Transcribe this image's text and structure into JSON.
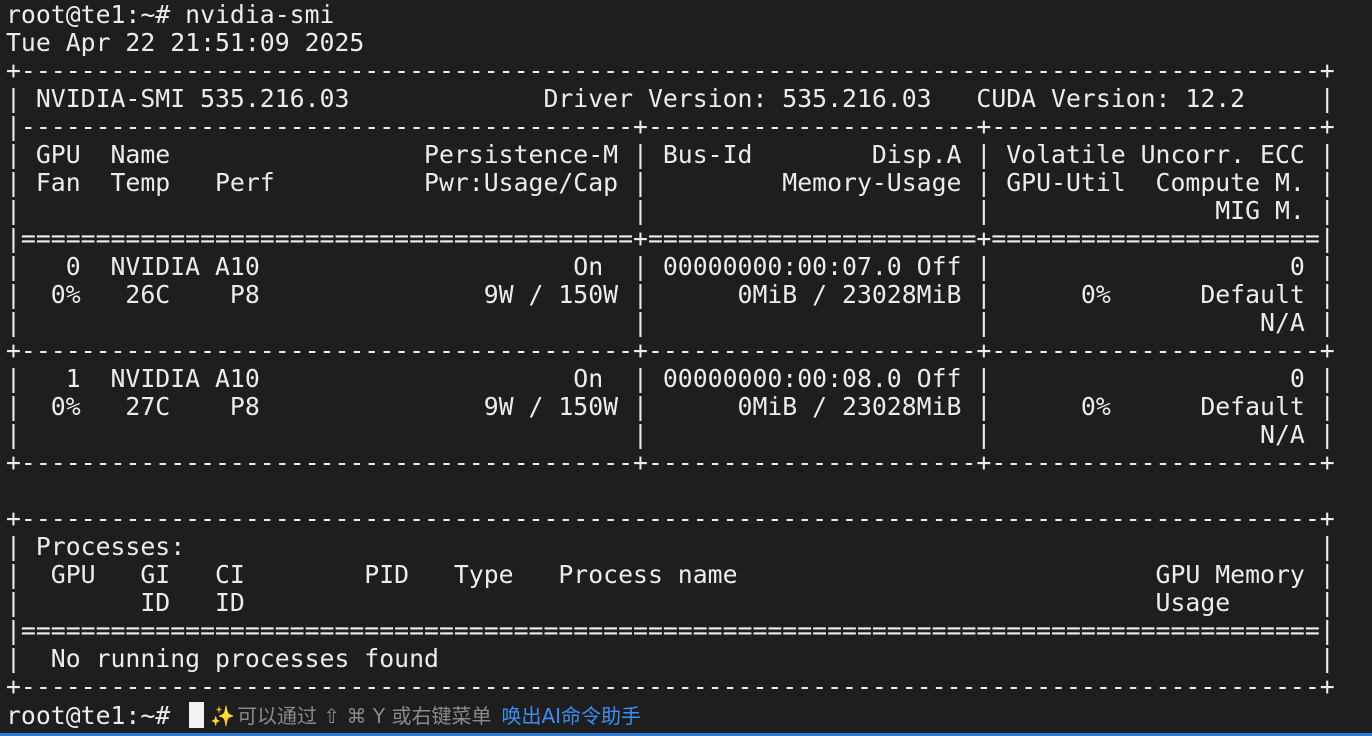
{
  "terminal": {
    "lines": [
      "root@te1:~# nvidia-smi",
      "Tue Apr 22 21:51:09 2025",
      "+---------------------------------------------------------------------------------------+",
      "| NVIDIA-SMI 535.216.03             Driver Version: 535.216.03   CUDA Version: 12.2     |",
      "|-----------------------------------------+----------------------+----------------------+",
      "| GPU  Name                 Persistence-M | Bus-Id        Disp.A | Volatile Uncorr. ECC |",
      "| Fan  Temp   Perf          Pwr:Usage/Cap |         Memory-Usage | GPU-Util  Compute M. |",
      "|                                         |                      |               MIG M. |",
      "|=========================================+======================+======================|",
      "|   0  NVIDIA A10                     On  | 00000000:00:07.0 Off |                    0 |",
      "|  0%   26C    P8               9W / 150W |      0MiB / 23028MiB |      0%      Default |",
      "|                                         |                      |                  N/A |",
      "+-----------------------------------------+----------------------+----------------------+",
      "|   1  NVIDIA A10                     On  | 00000000:00:08.0 Off |                    0 |",
      "|  0%   27C    P8               9W / 150W |      0MiB / 23028MiB |      0%      Default |",
      "|                                         |                      |                  N/A |",
      "+-----------------------------------------+----------------------+----------------------+",
      "",
      "+---------------------------------------------------------------------------------------+",
      "| Processes:                                                                            |",
      "|  GPU   GI   CI        PID   Type   Process name                            GPU Memory |",
      "|        ID   ID                                                             Usage      |",
      "|=======================================================================================|",
      "|  No running processes found                                                           |",
      "+---------------------------------------------------------------------------------------+"
    ],
    "prompt": "root@te1:~# ",
    "hint_text": "可以通过 ⇧ ⌘ Y 或右键菜单",
    "hint_action": "唤出AI命令助手",
    "sparkle_icon": "✨"
  }
}
